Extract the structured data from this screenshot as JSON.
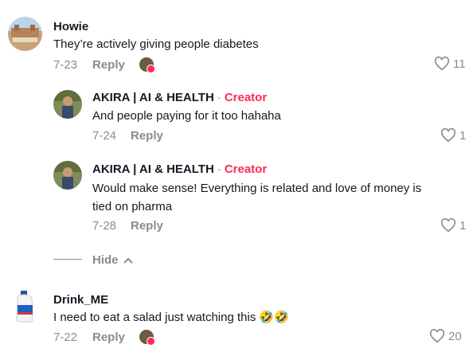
{
  "comments": [
    {
      "author": "Howie",
      "text": "They’re actively giving people diabetes",
      "date": "7-23",
      "reply_label": "Reply",
      "likes": "11"
    },
    {
      "author": "AKIRA | AI & HEALTH",
      "separator": "·",
      "badge": "Creator",
      "text": "And people paying for it too hahaha",
      "date": "7-24",
      "reply_label": "Reply",
      "likes": "1"
    },
    {
      "author": "AKIRA | AI & HEALTH",
      "separator": "·",
      "badge": "Creator",
      "text_line1": "Would make sense! Everything is related and love of money is",
      "text_line2": "tied on pharma",
      "date": "7-28",
      "reply_label": "Reply",
      "likes": "1"
    },
    {
      "author": "Drink_ME",
      "text": "I need to eat a salad just watching this",
      "emoji": "🤣🤣",
      "date": "7-22",
      "reply_label": "Reply",
      "likes": "20"
    }
  ],
  "hide_label": "Hide",
  "colors": {
    "accent": "#fe2c55",
    "muted": "#8a8b91",
    "text": "#161823"
  },
  "icons": [
    "heart-outline-icon",
    "chevron-up-icon",
    "liked-by-creator-icon"
  ]
}
